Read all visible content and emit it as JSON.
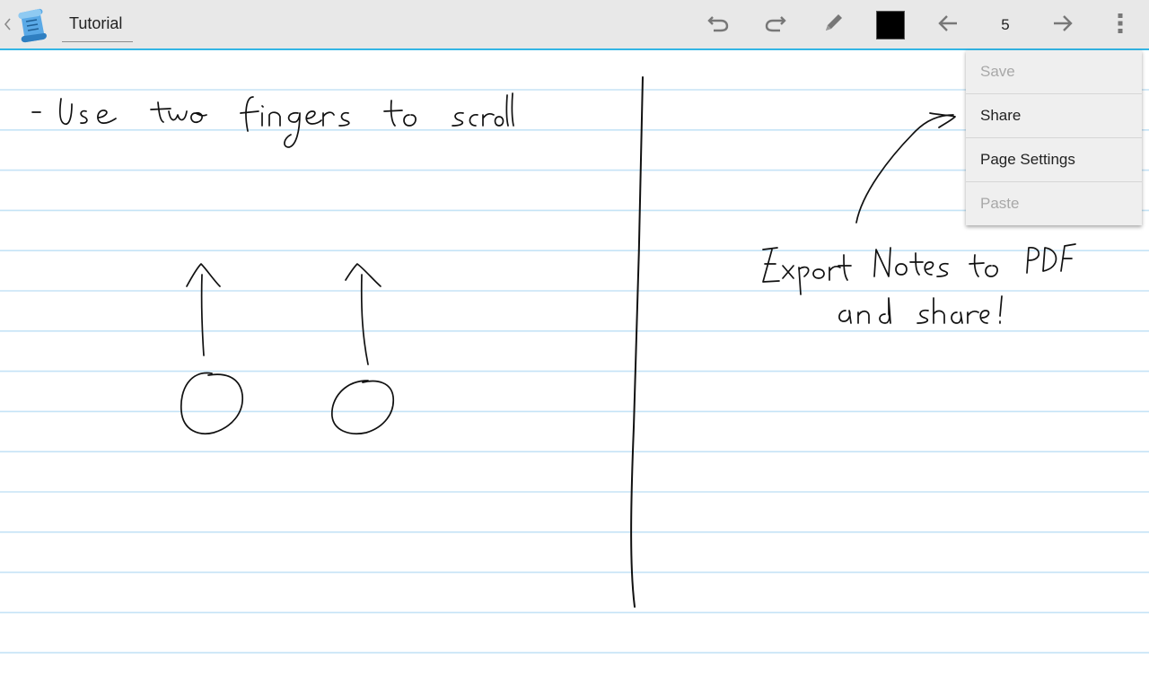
{
  "actionbar": {
    "title": "Tutorial",
    "page_number": "5",
    "current_color": "#000000",
    "accent_color": "#33b5e5",
    "icons": {
      "back": "chevron-left-icon",
      "logo": "scroll-app-icon",
      "undo": "undo-icon",
      "redo": "redo-icon",
      "pen": "pencil-icon",
      "prev": "arrow-left-icon",
      "next": "arrow-right-icon",
      "overflow": "more-vert-icon"
    }
  },
  "menu": {
    "items": [
      {
        "label": "Save",
        "enabled": false
      },
      {
        "label": "Share",
        "enabled": true
      },
      {
        "label": "Page Settings",
        "enabled": true
      },
      {
        "label": "Paste",
        "enabled": false
      }
    ]
  },
  "notebook": {
    "rule_color": "#c5e3f6",
    "handwriting": {
      "left_note": "- Use two fingers to scroll",
      "right_note_line1": "Export Notes to PDF",
      "right_note_line2": "and share !"
    }
  }
}
